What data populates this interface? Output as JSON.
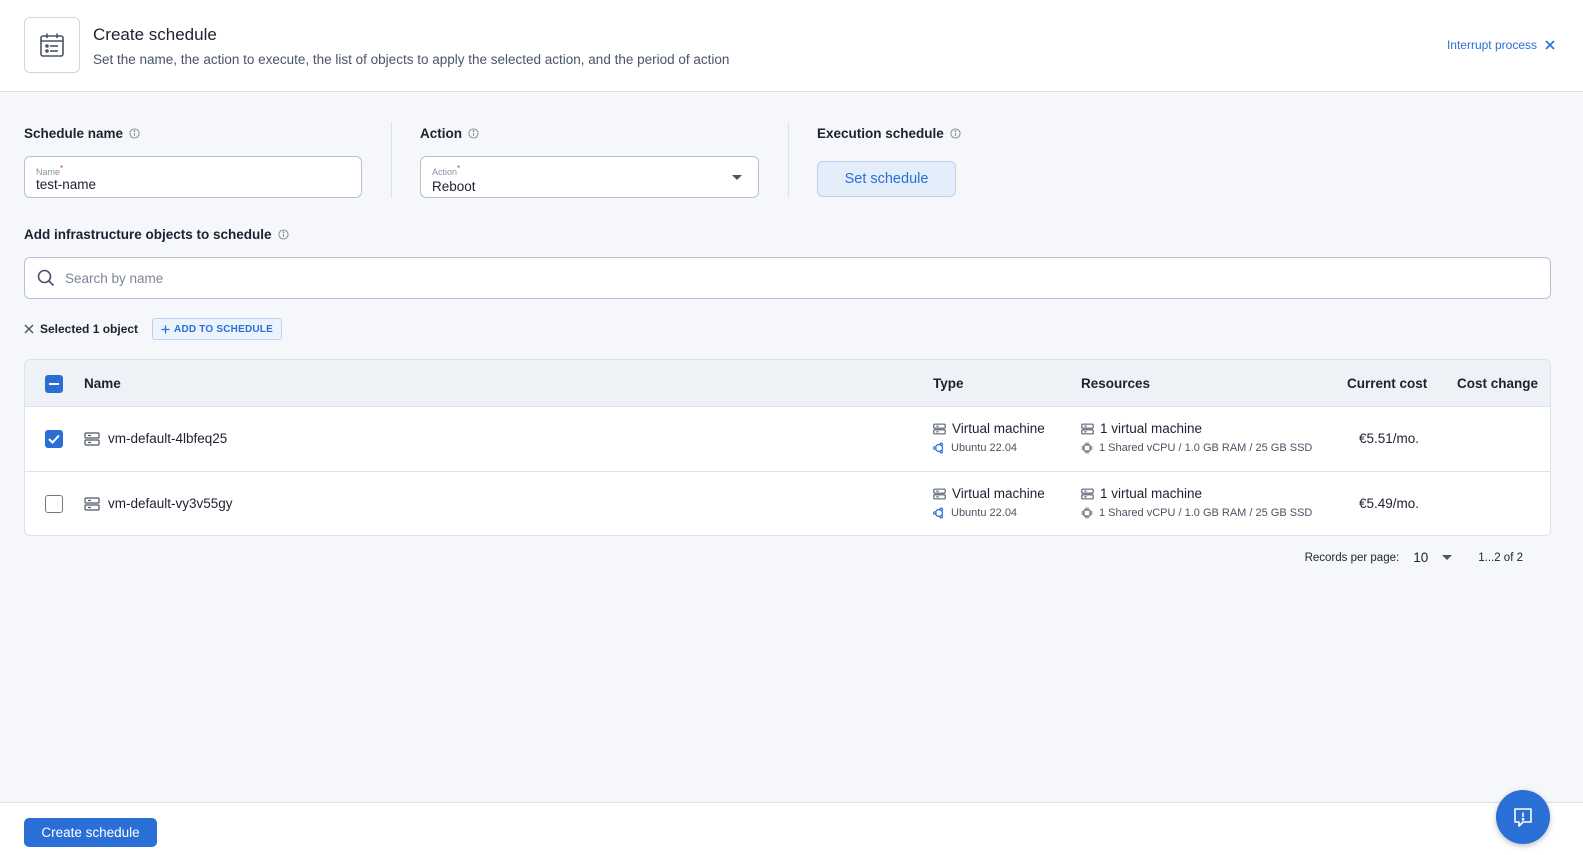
{
  "header": {
    "title": "Create schedule",
    "subtitle": "Set the name, the action to execute, the list of objects to apply the selected action, and the period of action",
    "interrupt_label": "Interrupt process"
  },
  "form": {
    "schedule_name_label": "Schedule name",
    "name_field_label": "Name",
    "name_value": "test-name",
    "action_label": "Action",
    "action_field_label": "Action",
    "action_value": "Reboot",
    "execution_label": "Execution schedule",
    "set_schedule_label": "Set schedule"
  },
  "objects": {
    "label": "Add infrastructure objects to schedule",
    "search_placeholder": "Search by name",
    "selected_text": "Selected 1 object",
    "add_to_schedule_label": "ADD TO SCHEDULE"
  },
  "table": {
    "columns": [
      "Name",
      "Type",
      "Resources",
      "Current cost",
      "Cost change"
    ],
    "rows": [
      {
        "checked": true,
        "name": "vm-default-4lbfeq25",
        "type": "Virtual machine",
        "os": "Ubuntu 22.04",
        "resources": "1 virtual machine",
        "spec": "1 Shared vCPU / 1.0 GB RAM / 25 GB SSD",
        "cost": "€5.51/mo."
      },
      {
        "checked": false,
        "name": "vm-default-vy3v55gy",
        "type": "Virtual machine",
        "os": "Ubuntu 22.04",
        "resources": "1 virtual machine",
        "spec": "1 Shared vCPU / 1.0 GB RAM / 25 GB SSD",
        "cost": "€5.49/mo."
      }
    ]
  },
  "pagination": {
    "records_label": "Records per page:",
    "per_page": "10",
    "range": "1...2 of 2"
  },
  "footer": {
    "create_label": "Create schedule"
  },
  "icons": {
    "header": "calendar-icon",
    "interrupt": "close-icon",
    "info": "info-icon",
    "search": "search-icon",
    "deselect": "close-icon",
    "add": "plus-icon",
    "row": "server-icon",
    "os": "ubuntu-icon",
    "spec": "chip-icon",
    "chat": "chat-icon"
  },
  "colors": {
    "accent": "#2a6fd6",
    "background": "#f5f7fb"
  }
}
